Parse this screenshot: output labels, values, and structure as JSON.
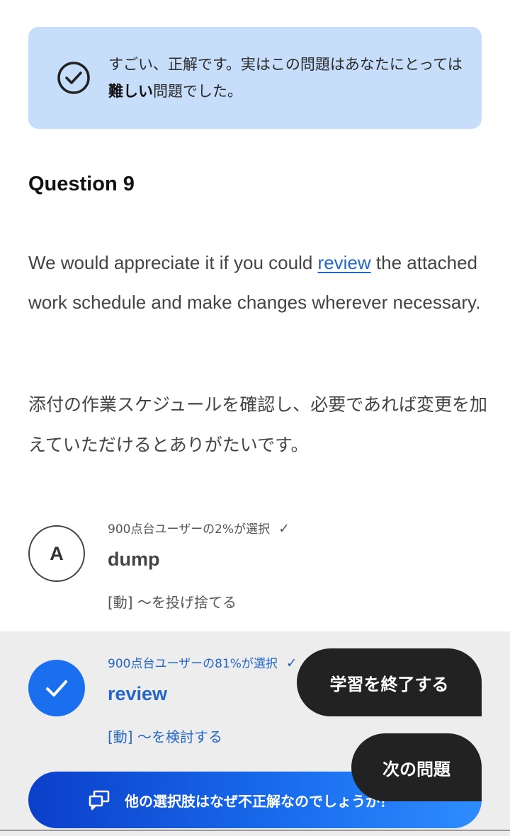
{
  "result_banner": {
    "text_before": "すごい、正解です。実はこの問題はあなたにとっては",
    "text_bold": "難しい",
    "text_after": "問題でした。"
  },
  "question": {
    "title": "Question 9",
    "sentence_en_before": "We would appreciate it if you could ",
    "sentence_en_link": "review",
    "sentence_en_after": " the attached work schedule and make changes wherever necessary.",
    "sentence_ja": "添付の作業スケジュールを確認し、必要であれば変更を加えていただけるとありがたいです。"
  },
  "options": [
    {
      "letter": "A",
      "stat": "900点台ユーザーの2%が選択",
      "word": "dump",
      "meaning": "[動] ～を投げ捨てる"
    },
    {
      "stat": "900点台ユーザーの81%が選択",
      "word": "review",
      "meaning": "[動] ～を検討する"
    }
  ],
  "stat_tick": "✓",
  "buttons": {
    "finish": "学習を終了する",
    "next": "次の問題",
    "explain": "他の選択肢はなぜ不正解なのでしょうか？"
  },
  "colors": {
    "banner_bg": "#c7defb",
    "accent_blue": "#1a6fef",
    "fab_bg": "#222222"
  }
}
